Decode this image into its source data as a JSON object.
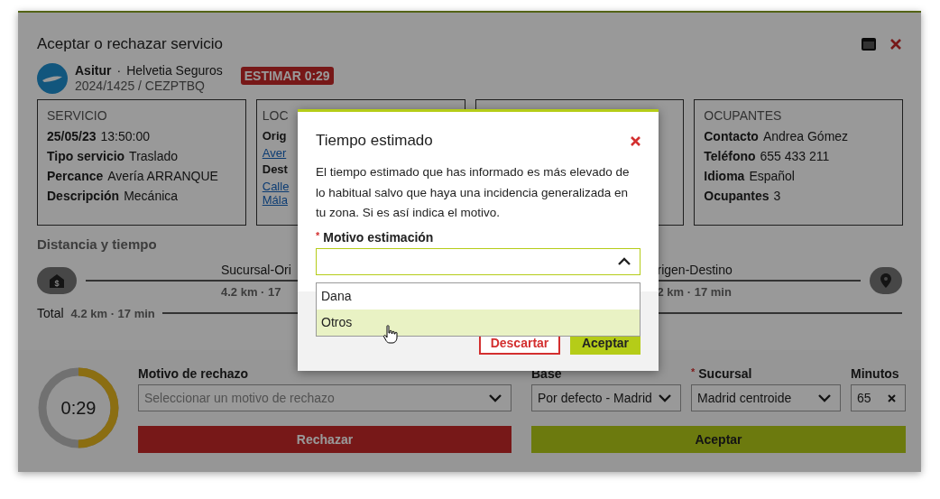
{
  "window": {
    "title": "Aceptar o rechazar servicio"
  },
  "header": {
    "company": "Asitur",
    "separator": "·",
    "insurer": "Helvetia Seguros",
    "reference": "2024/1425 / CEZPTBQ",
    "badge": "ESTIMAR 0:29"
  },
  "cards": [
    {
      "heading": "SERVICIO",
      "rows": [
        {
          "kind": "pair",
          "label": "25/05/23",
          "value": "13:50:00"
        },
        {
          "kind": "pair",
          "label": "Tipo servicio",
          "value": "Traslado"
        },
        {
          "kind": "pair",
          "label": "Percance",
          "value": "Avería ARRANQUE"
        },
        {
          "kind": "pair",
          "label": "Descripción",
          "value": "Mecánica"
        }
      ]
    },
    {
      "heading": "LOC",
      "rows": [
        {
          "kind": "label",
          "text": "Orig"
        },
        {
          "kind": "link",
          "text": "Aver"
        },
        {
          "kind": "label",
          "text": "Dest"
        },
        {
          "kind": "link",
          "text": "Calle"
        },
        {
          "kind": "link",
          "text": "Mála"
        }
      ]
    },
    {
      "heading": "OCUPANTES",
      "rows": [
        {
          "kind": "pair",
          "label": "Contacto",
          "value": "Andrea Gómez"
        },
        {
          "kind": "pair",
          "label": "Teléfono",
          "value": "655 433 211"
        },
        {
          "kind": "pair",
          "label": "Idioma",
          "value": "Español"
        },
        {
          "kind": "pair",
          "label": "Ocupantes",
          "value": "3"
        }
      ]
    }
  ],
  "distance": {
    "title": "Distancia y tiempo",
    "start_glyph": "$",
    "segments": [
      {
        "name": "Sucursal-Ori",
        "metrics": "4.2 km · 17"
      },
      {
        "name": "rigen-Destino",
        "metrics": "2 km · 17 min"
      }
    ],
    "total_label": "Total",
    "total": "4.2 km · 17 min"
  },
  "timer": {
    "text": "0:29",
    "level": 0.5
  },
  "reject": {
    "label": "Motivo de rechazo",
    "placeholder": "Seleccionar un motivo de rechazo",
    "button": "Rechazar"
  },
  "base": {
    "label": "Base",
    "value": "Por defecto - Madrid"
  },
  "branch": {
    "label": "Sucursal",
    "required_mark": "*",
    "value": "Madrid centroide"
  },
  "minutes": {
    "label": "Minutos",
    "value": "65"
  },
  "accept_button": "Aceptar",
  "dialog": {
    "title": "Tiempo estimado",
    "text": "El tiempo estimado que has informado es más elevado de lo habitual salvo que haya una incidencia generalizada en tu zona. Si es así indica el motivo.",
    "field_label": "Motivo estimación",
    "required_mark": "*",
    "expanded": true,
    "options": [
      {
        "label": "Dana",
        "highlighted": false
      },
      {
        "label": "Otros",
        "highlighted": true
      }
    ],
    "discard": "Descartar",
    "accept": "Aceptar"
  }
}
